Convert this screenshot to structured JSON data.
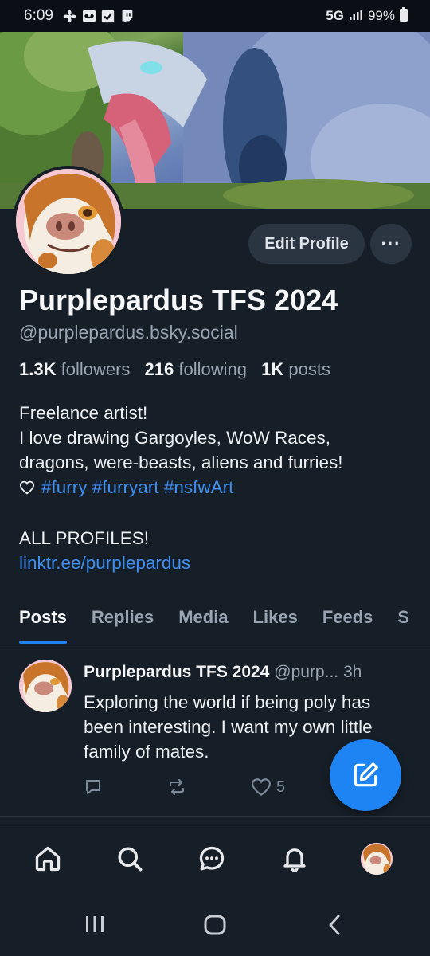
{
  "status_bar": {
    "time": "6:09",
    "network": "5G",
    "battery": "99%",
    "icons": [
      "fan-icon",
      "voicemail-icon",
      "checkbox-icon",
      "twitch-icon"
    ]
  },
  "profile": {
    "display_name": "Purplepardus TFS 2024",
    "handle": "@purplepardus.bsky.social",
    "edit_button": "Edit Profile",
    "more_button": "···",
    "stats": {
      "followers_count": "1.3K",
      "followers_label": "followers",
      "following_count": "216",
      "following_label": "following",
      "posts_count": "1K",
      "posts_label": "posts"
    },
    "bio": {
      "line1": "Freelance artist!",
      "line2": "I love drawing Gargoyles, WoW Races,",
      "line3": "dragons, were-beasts, aliens and furries!",
      "tag1": "#furry",
      "tag2": "#furryart",
      "tag3": "#nsfwArt",
      "line5": "ALL PROFILES!",
      "link": "linktr.ee/purplepardus"
    }
  },
  "tabs": [
    {
      "label": "Posts",
      "active": true
    },
    {
      "label": "Replies"
    },
    {
      "label": "Media"
    },
    {
      "label": "Likes"
    },
    {
      "label": "Feeds"
    },
    {
      "label": "S"
    }
  ],
  "post": {
    "author": "Purplepardus TFS 2024",
    "handle": "@purp...",
    "time": "3h",
    "text": "Exploring the world if being poly has been interesting. I want my own little family of mates.",
    "like_count": "5"
  },
  "colors": {
    "background": "#161e27",
    "accent": "#1e83f3",
    "link": "#3f8ef0",
    "muted": "#9aa6b3"
  }
}
